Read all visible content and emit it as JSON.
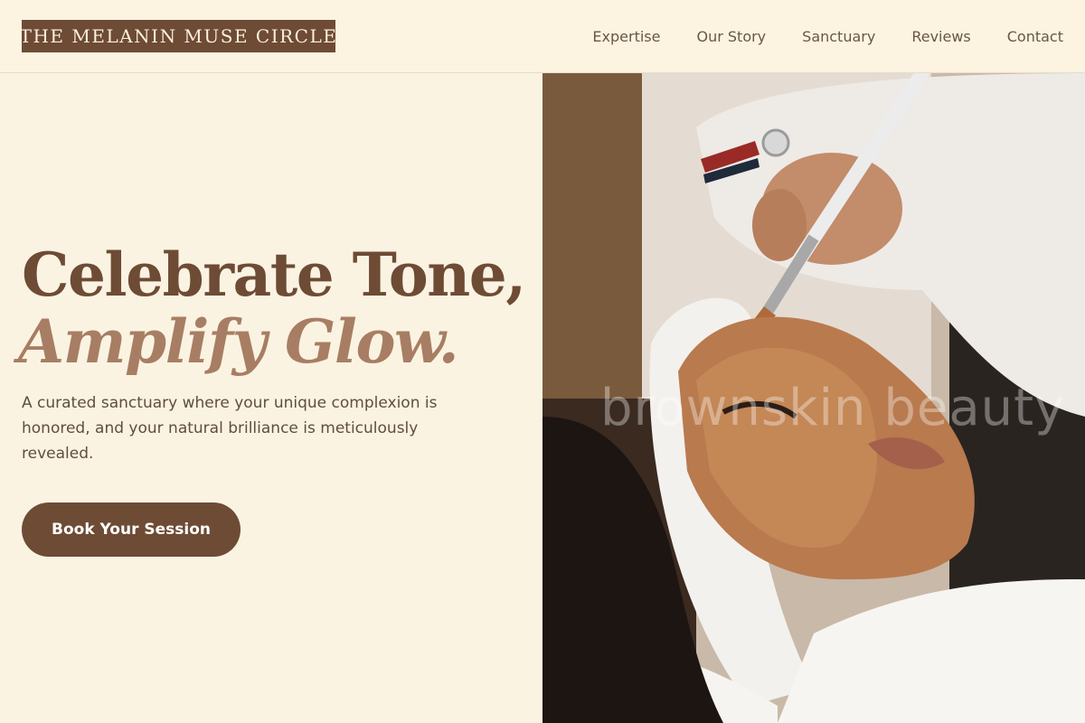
{
  "brand": {
    "name": "THE MELANIN MUSE CIRCLE"
  },
  "nav": {
    "items": [
      {
        "label": "Expertise"
      },
      {
        "label": "Our Story"
      },
      {
        "label": "Sanctuary"
      },
      {
        "label": "Reviews"
      },
      {
        "label": "Contact"
      }
    ]
  },
  "hero": {
    "headline_line1": "Celebrate Tone,",
    "headline_line2": "Amplify Glow.",
    "subtext": "A curated sanctuary where your unique complexion is honored, and your natural brilliance is meticulously revealed.",
    "cta_label": "Book Your Session",
    "image": {
      "icon": "facial-treatment-photo",
      "watermark": "brownskin beauty"
    }
  },
  "colors": {
    "background": "#fbf3e2",
    "brand_brown": "#6e4b35",
    "accent_tan": "#a77e63",
    "text": "#5f4e41"
  }
}
